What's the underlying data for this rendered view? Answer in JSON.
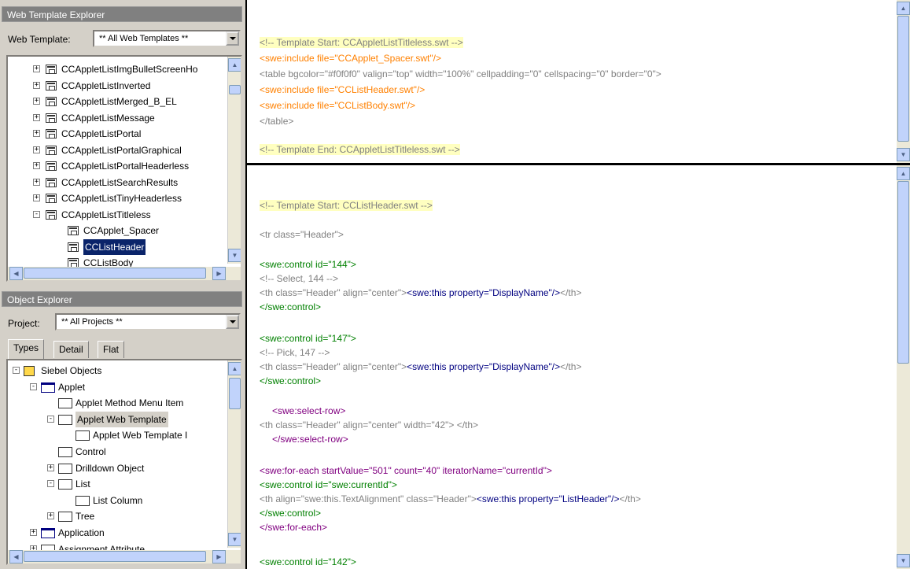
{
  "web_template_explorer": {
    "title": "Web Template Explorer",
    "label": "Web Template:",
    "combo_value": "** All Web Templates **",
    "items": [
      {
        "label": "CCAppletListImgBulletScreenHo",
        "expander": "+"
      },
      {
        "label": "CCAppletListInverted",
        "expander": "+"
      },
      {
        "label": "CCAppletListMerged_B_EL",
        "expander": "+"
      },
      {
        "label": "CCAppletListMessage",
        "expander": "+"
      },
      {
        "label": "CCAppletListPortal",
        "expander": "+"
      },
      {
        "label": "CCAppletListPortalGraphical",
        "expander": "+"
      },
      {
        "label": "CCAppletListPortalHeaderless",
        "expander": "+"
      },
      {
        "label": "CCAppletListSearchResults",
        "expander": "+"
      },
      {
        "label": "CCAppletListTinyHeaderless",
        "expander": "+"
      },
      {
        "label": "CCAppletListTitleless",
        "expander": "−"
      },
      {
        "label": "CCApplet_Spacer",
        "expander": ""
      },
      {
        "label": "CCListHeader",
        "expander": ""
      },
      {
        "label": "CCListBody",
        "expander": ""
      }
    ]
  },
  "object_explorer": {
    "title": "Object Explorer",
    "label": "Project:",
    "combo_value": "** All Projects **",
    "tabs": [
      "Types",
      "Detail",
      "Flat"
    ],
    "items": [
      {
        "label": "Siebel Objects",
        "expander": "−"
      },
      {
        "label": "Applet",
        "expander": "−"
      },
      {
        "label": "Applet Method Menu Item",
        "expander": ""
      },
      {
        "label": "Applet Web Template",
        "expander": "−"
      },
      {
        "label": "Applet Web Template I",
        "expander": ""
      },
      {
        "label": "Control",
        "expander": ""
      },
      {
        "label": "Drilldown Object",
        "expander": "+"
      },
      {
        "label": "List",
        "expander": "−"
      },
      {
        "label": "List Column",
        "expander": ""
      },
      {
        "label": "Tree",
        "expander": "+"
      },
      {
        "label": "Application",
        "expander": "+"
      },
      {
        "label": "Assignment Attribute",
        "expander": "+"
      }
    ]
  },
  "top_pane": {
    "lines": [
      "<!-- Template Start: CCAppletListTitleless.swt -->",
      "<swe:include file=\"CCApplet_Spacer.swt\"/>",
      "<table bgcolor=\"#f0f0f0\" valign=\"top\" width=\"100%\" cellpadding=\"0\" cellspacing=\"0\" border=\"0\">",
      "<swe:include file=\"CCListHeader.swt\"/>",
      "<swe:include file=\"CCListBody.swt\"/>",
      "</table>",
      "<!-- Template End: CCAppletListTitleless.swt -->"
    ]
  },
  "bottom_pane": {
    "l1": "<!-- Template Start: CCListHeader.swt -->",
    "l2": "<tr class=\"Header\">",
    "l3": "<swe:control id=\"144\">",
    "l4": "<!-- Select, 144 -->",
    "l5a": "<th class=\"Header\" align=\"center\">",
    "l5b": "<swe:this property=\"DisplayName\"/>",
    "l5c": "</th>",
    "l6": "</swe:control>",
    "l7": "<swe:control id=\"147\">",
    "l8": "<!-- Pick, 147 -->",
    "l9a": "<th class=\"Header\" align=\"center\">",
    "l9b": "<swe:this property=\"DisplayName\"/>",
    "l9c": "</th>",
    "l10": "</swe:control>",
    "l11": "<swe:select-row>",
    "l12": "<th class=\"Header\" align=\"center\" width=\"42\"> </th>",
    "l13": "</swe:select-row>",
    "l14": "<swe:for-each startValue=\"501\" count=\"40\" iteratorName=\"currentId\">",
    "l15": "<swe:control id=\"swe:currentId\">",
    "l16a": "<th align=\"swe:this.TextAlignment\" class=\"Header\">",
    "l16b": "<swe:this property=\"ListHeader\"/>",
    "l16c": "</th>",
    "l17": "</swe:control>",
    "l18": "</swe:for-each>",
    "l19": "<swe:control id=\"142\">"
  }
}
